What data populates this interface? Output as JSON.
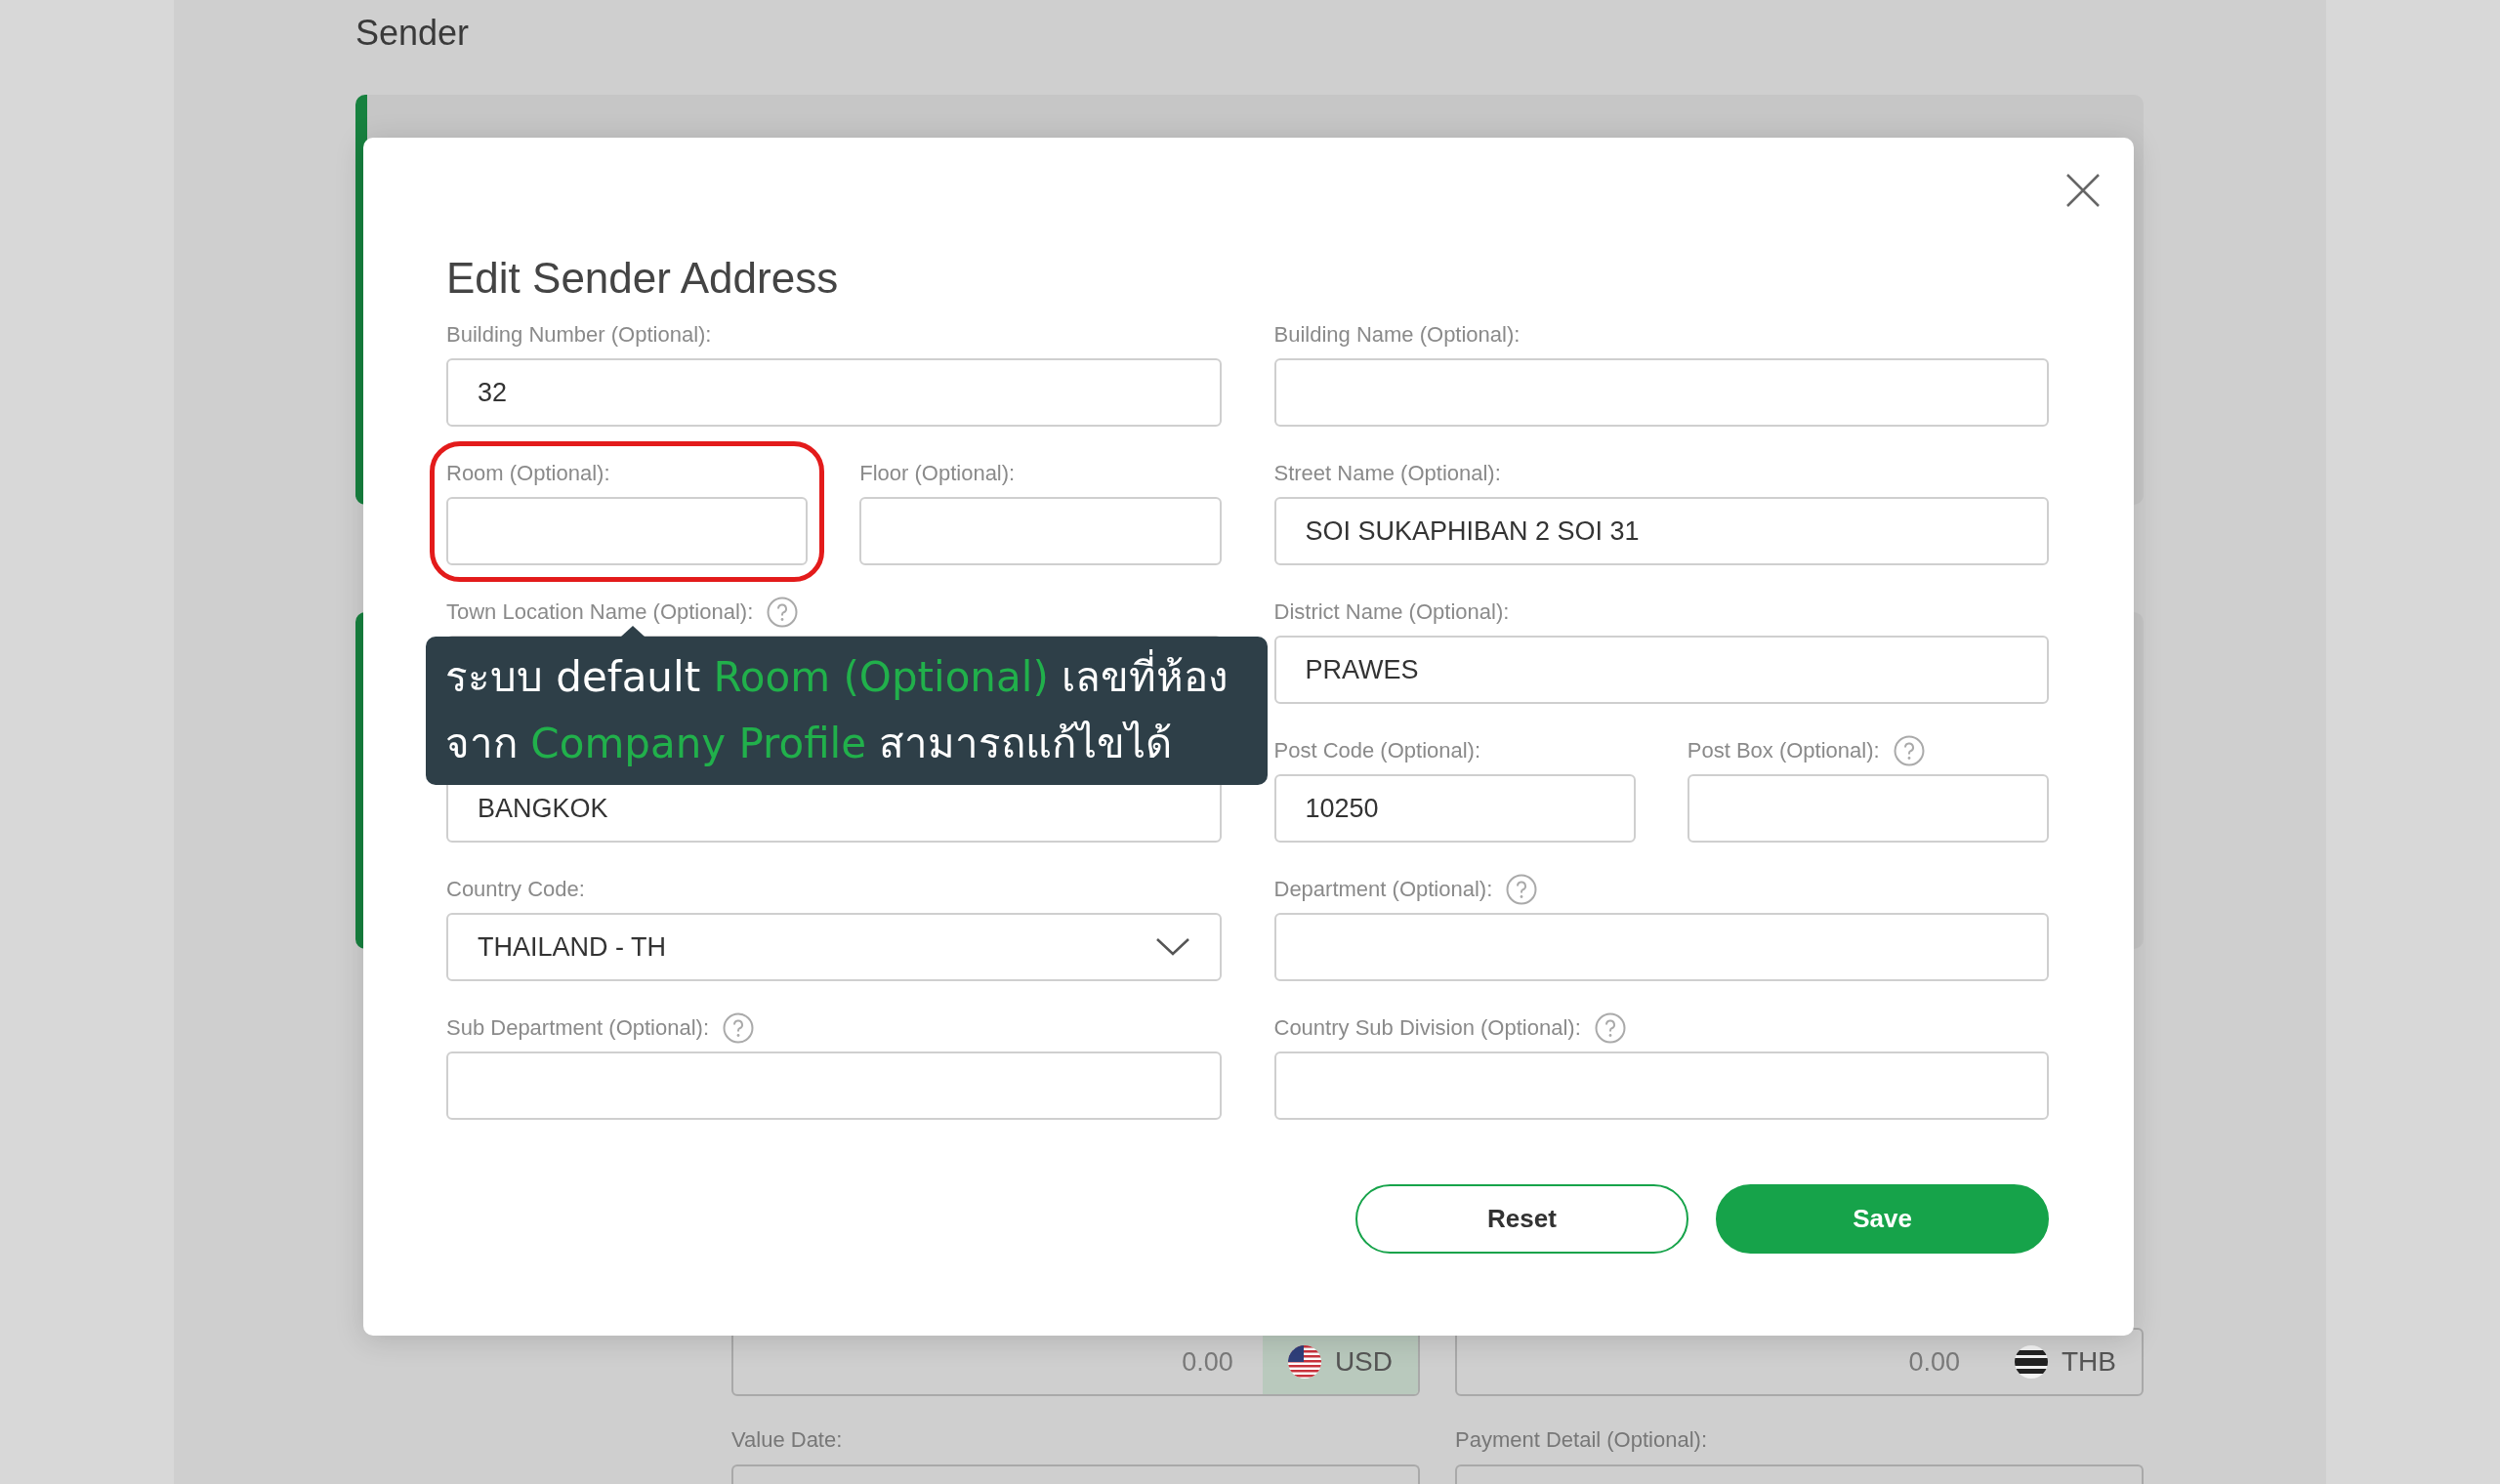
{
  "background": {
    "section_title": "Sender",
    "amounts": [
      {
        "value": "0.00",
        "currency": "USD",
        "kind": "us",
        "highlighted": true
      },
      {
        "value": "0.00",
        "currency": "THB",
        "kind": "th",
        "highlighted": false
      }
    ],
    "field_labels": [
      "Value Date:",
      "Payment Detail (Optional):"
    ]
  },
  "dialog": {
    "title": "Edit Sender Address",
    "rows": [
      {
        "left": [
          {
            "kind": "text",
            "label": "Building Number (Optional):",
            "value": "32",
            "help": false,
            "annotated": false
          }
        ],
        "right": [
          {
            "kind": "text",
            "label": "Building Name (Optional):",
            "help": false,
            "annotated": false
          }
        ]
      },
      {
        "left": [
          {
            "kind": "text",
            "label": "Room (Optional):",
            "help": false,
            "annotated": true
          },
          {
            "kind": "text",
            "label": "Floor (Optional):",
            "help": false,
            "annotated": false
          }
        ],
        "right": [
          {
            "kind": "text",
            "label": "Street Name (Optional):",
            "value": "SOI SUKAPHIBAN 2 SOI 31",
            "help": false,
            "annotated": false
          }
        ]
      },
      {
        "left": [
          {
            "kind": "text",
            "label": "Town Location Name (Optional):",
            "help": true,
            "annotated": false
          }
        ],
        "right": [
          {
            "kind": "text",
            "label": "District Name (Optional):",
            "value": "PRAWES",
            "help": false,
            "annotated": false
          }
        ]
      },
      {
        "left": [
          {
            "kind": "text",
            "value": "BANGKOK",
            "help": false,
            "annotated": false
          }
        ],
        "right": [
          {
            "kind": "text",
            "label": "Post Code (Optional):",
            "value": "10250",
            "help": false,
            "annotated": false
          },
          {
            "kind": "text",
            "label": "Post Box (Optional):",
            "help": true,
            "annotated": false
          }
        ]
      },
      {
        "left": [
          {
            "kind": "select",
            "label": "Country Code:",
            "value": "THAILAND - TH",
            "help": false,
            "annotated": false
          }
        ],
        "right": [
          {
            "kind": "text",
            "label": "Department (Optional):",
            "help": true,
            "annotated": false
          }
        ]
      },
      {
        "left": [
          {
            "kind": "text",
            "label": "Sub Department (Optional):",
            "help": true,
            "annotated": false
          }
        ],
        "right": [
          {
            "kind": "text",
            "label": "Country Sub Division (Optional):",
            "help": true,
            "annotated": false
          }
        ]
      }
    ],
    "buttons": [
      {
        "label": "Reset",
        "kind": "secondary"
      },
      {
        "label": "Save",
        "kind": "primary"
      }
    ]
  },
  "tooltip": {
    "lines": [
      [
        {
          "text": "ระบบ default ",
          "highlight": false
        },
        {
          "text": "Room (Optional)",
          "highlight": true
        },
        {
          "text": " เลขที่ห้อง",
          "highlight": false
        }
      ],
      [
        {
          "text": "จาก ",
          "highlight": false
        },
        {
          "text": "Company Profile",
          "highlight": true
        },
        {
          "text": " สามารถแก้ไขได้",
          "highlight": false
        }
      ]
    ]
  }
}
